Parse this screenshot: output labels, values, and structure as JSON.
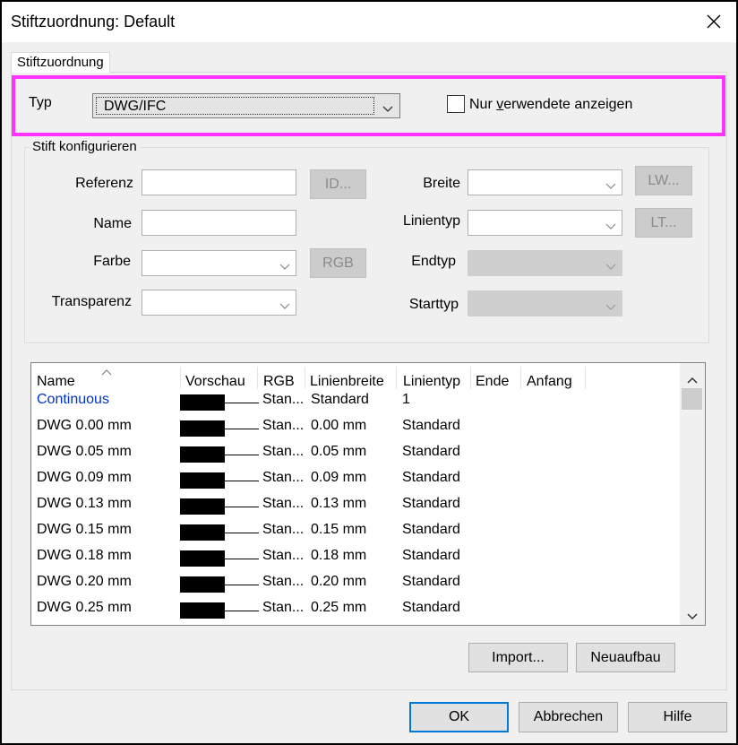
{
  "window": {
    "title": "Stiftzuordnung: Default"
  },
  "tab": {
    "label": "Stiftzuordnung"
  },
  "typ": {
    "label": "Typ",
    "value": "DWG/IFC"
  },
  "checkbox": {
    "label_prefix": "Nur ",
    "label_underlined": "v",
    "label_rest": "erwendete anzeigen",
    "checked": false
  },
  "group": {
    "title": "Stift konfigurieren",
    "referenz_label": "Referenz",
    "name_label": "Name",
    "farbe_label": "Farbe",
    "transparenz_label": "Transparenz",
    "breite_label": "Breite",
    "linientyp_label": "Linientyp",
    "endtyp_label": "Endtyp",
    "starttyp_label": "Starttyp",
    "id_button": "ID...",
    "rgb_button": "RGB",
    "lw_button": "LW...",
    "lt_button": "LT..."
  },
  "table": {
    "columns": [
      "Name",
      "Vorschau",
      "RGB",
      "Linienbreite",
      "Linientyp",
      "Ende",
      "Anfang"
    ],
    "rows": [
      {
        "name": "Continuous",
        "rgb": "Stan...",
        "width": "Standard",
        "linetype": "1",
        "link": true
      },
      {
        "name": "DWG 0.00 mm",
        "rgb": "Stan...",
        "width": "0.00 mm",
        "linetype": "Standard",
        "link": false
      },
      {
        "name": "DWG 0.05 mm",
        "rgb": "Stan...",
        "width": "0.05 mm",
        "linetype": "Standard",
        "link": false
      },
      {
        "name": "DWG 0.09 mm",
        "rgb": "Stan...",
        "width": "0.09 mm",
        "linetype": "Standard",
        "link": false
      },
      {
        "name": "DWG 0.13 mm",
        "rgb": "Stan...",
        "width": "0.13 mm",
        "linetype": "Standard",
        "link": false
      },
      {
        "name": "DWG 0.15 mm",
        "rgb": "Stan...",
        "width": "0.15 mm",
        "linetype": "Standard",
        "link": false
      },
      {
        "name": "DWG 0.18 mm",
        "rgb": "Stan...",
        "width": "0.18 mm",
        "linetype": "Standard",
        "link": false
      },
      {
        "name": "DWG 0.20 mm",
        "rgb": "Stan...",
        "width": "0.20 mm",
        "linetype": "Standard",
        "link": false
      },
      {
        "name": "DWG 0.25 mm",
        "rgb": "Stan...",
        "width": "0.25 mm",
        "linetype": "Standard",
        "link": false
      }
    ]
  },
  "buttons": {
    "import": "Import...",
    "neuaufbau": "Neuaufbau",
    "ok": "OK",
    "abbrechen": "Abbrechen",
    "hilfe": "Hilfe"
  },
  "colors": {
    "highlight": "#ff33ff",
    "link": "#0033cc",
    "default_button_border": "#0078d7"
  },
  "icons": {
    "close": "close-icon",
    "chevron": "chevron-down-icon",
    "sort": "sort-up-icon",
    "scroll_up": "scroll-up-icon",
    "scroll_down": "scroll-down-icon"
  }
}
